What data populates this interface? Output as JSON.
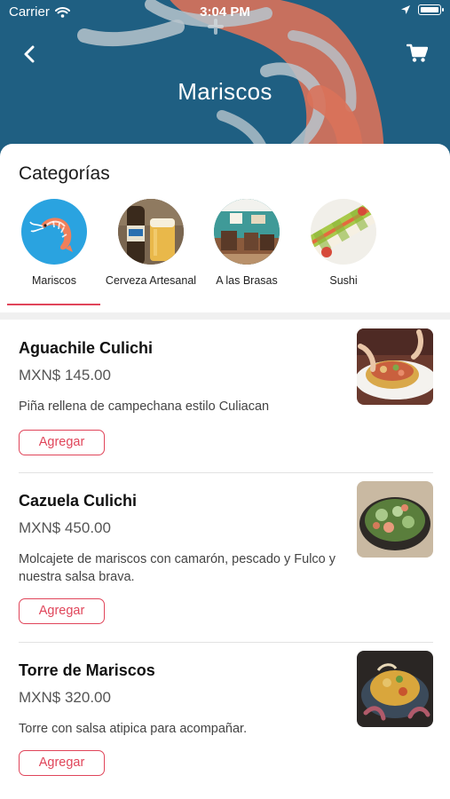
{
  "status_bar": {
    "carrier": "Carrier",
    "time": "3:04 PM",
    "battery_level": 1.0
  },
  "header": {
    "title": "Mariscos",
    "back_icon": "chevron-left-icon",
    "cart_icon": "cart-icon",
    "background_color": "#1f5f82"
  },
  "categories": {
    "title": "Categorías",
    "selected_index": 0,
    "items": [
      {
        "label": "Mariscos",
        "icon": "shrimp-icon"
      },
      {
        "label": "Cerveza Artesanal",
        "icon": "beer-photo"
      },
      {
        "label": "A las Brasas",
        "icon": "restaurant-photo"
      },
      {
        "label": "Sushi",
        "icon": "sushi-photo"
      }
    ]
  },
  "products": [
    {
      "name": "Aguachile Culichi",
      "price": "MXN$ 145.00",
      "description": "Piña rellena de campechana estilo Culiacan",
      "button_label": "Agregar"
    },
    {
      "name": "Cazuela Culichi",
      "price": "MXN$ 450.00",
      "description": "Molcajete de mariscos con camarón, pescado y Fulco y nuestra salsa brava.",
      "button_label": "Agregar"
    },
    {
      "name": "Torre de Mariscos",
      "price": "MXN$ 320.00",
      "description": "Torre con salsa atipica para acompañar.",
      "button_label": "Agregar"
    }
  ],
  "colors": {
    "accent": "#e0455a",
    "header_blue": "#1f5f82",
    "shrimp_circle": "#2aa3e0"
  }
}
